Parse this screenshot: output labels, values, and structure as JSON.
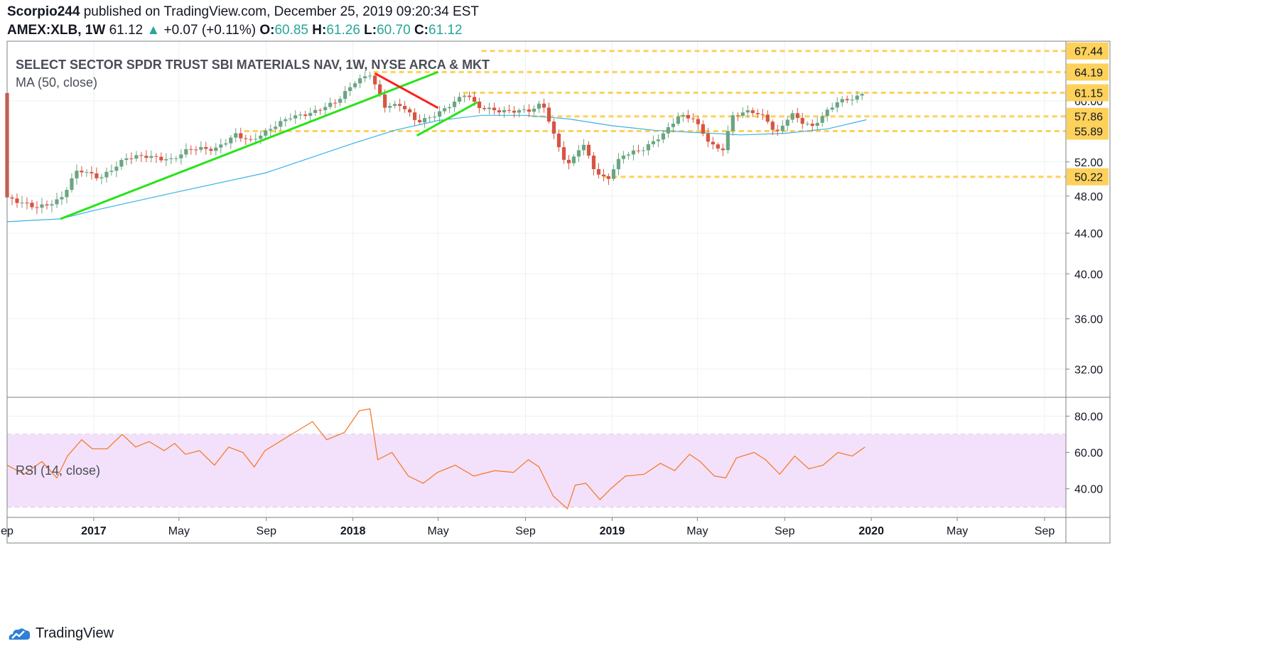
{
  "header": {
    "author": "Scorpio244",
    "published_text": "published on TradingView.com, December 25, 2019 09:20:34 EST",
    "symbol": "AMEX:XLB, 1W",
    "last": "61.12",
    "change_arrow": "▲",
    "change": "+0.07 (+0.11%)",
    "o_label": "O:",
    "o_value": "60.85",
    "h_label": "H:",
    "h_value": "61.26",
    "l_label": "L:",
    "l_value": "60.70",
    "c_label": "C:",
    "c_value": "61.12"
  },
  "price_pane": {
    "title": "SELECT SECTOR SPDR TRUST SBI MATERIALS NAV, 1W, NYSE ARCA & MKT",
    "indicator": "MA (50, close)"
  },
  "rsi_pane": {
    "indicator": "RSI (14, close)"
  },
  "footer": {
    "brand": "TradingView"
  },
  "colors": {
    "up_candle": "#6ba583",
    "down_candle": "#d75442",
    "ma_line": "#3bb3e4",
    "rsi_line": "#f57c2e",
    "rsi_band": "#f3e1fb",
    "level_line": "#fdd15a",
    "trend_green": "#29e31b",
    "trend_red": "#ff1f1f",
    "grid": "#eef0f3"
  },
  "chart_data": [
    {
      "type": "candlestick",
      "title": "SELECT SECTOR SPDR TRUST SBI MATERIALS NAV, 1W, NYSE ARCA & MKT",
      "xlim": [
        "2016-09-01",
        "2020-10-01"
      ],
      "ylim": [
        30,
        69
      ],
      "y_scale": "log",
      "y_ticks": [
        32.0,
        36.0,
        40.0,
        44.0,
        48.0,
        52.0,
        60.0
      ],
      "x_ticks": [
        {
          "label": "ep",
          "date": "2016-09-01"
        },
        {
          "label": "2017",
          "date": "2017-01-01"
        },
        {
          "label": "May",
          "date": "2017-05-01"
        },
        {
          "label": "Sep",
          "date": "2017-09-01"
        },
        {
          "label": "2018",
          "date": "2018-01-01"
        },
        {
          "label": "May",
          "date": "2018-05-01"
        },
        {
          "label": "Sep",
          "date": "2018-09-01"
        },
        {
          "label": "2019",
          "date": "2019-01-01"
        },
        {
          "label": "May",
          "date": "2019-05-01"
        },
        {
          "label": "Sep",
          "date": "2019-09-01"
        },
        {
          "label": "2020",
          "date": "2020-01-01"
        },
        {
          "label": "May",
          "date": "2020-05-01"
        },
        {
          "label": "Sep",
          "date": "2020-09-01"
        }
      ],
      "close_series": [
        [
          "2016-09-01",
          47.6
        ],
        [
          "2016-10-15",
          46.9
        ],
        [
          "2016-11-15",
          47.5
        ],
        [
          "2016-12-10",
          51.0
        ],
        [
          "2017-01-10",
          50.2
        ],
        [
          "2017-02-15",
          52.4
        ],
        [
          "2017-03-15",
          52.6
        ],
        [
          "2017-04-20",
          52.4
        ],
        [
          "2017-05-15",
          53.6
        ],
        [
          "2017-06-20",
          53.4
        ],
        [
          "2017-07-20",
          55.6
        ],
        [
          "2017-08-10",
          54.7
        ],
        [
          "2017-09-01",
          55.7
        ],
        [
          "2017-10-05",
          57.8
        ],
        [
          "2017-11-05",
          58.5
        ],
        [
          "2017-12-10",
          59.8
        ],
        [
          "2018-01-05",
          62.8
        ],
        [
          "2018-01-25",
          64.0
        ],
        [
          "2018-02-15",
          59.3
        ],
        [
          "2018-03-10",
          59.3
        ],
        [
          "2018-04-01",
          57.0
        ],
        [
          "2018-04-20",
          57.8
        ],
        [
          "2018-05-15",
          59.3
        ],
        [
          "2018-06-10",
          61.0
        ],
        [
          "2018-06-25",
          59.0
        ],
        [
          "2018-07-25",
          58.7
        ],
        [
          "2018-08-20",
          58.7
        ],
        [
          "2018-09-10",
          58.6
        ],
        [
          "2018-09-25",
          59.6
        ],
        [
          "2018-10-10",
          55.5
        ],
        [
          "2018-10-30",
          51.5
        ],
        [
          "2018-11-20",
          54.5
        ],
        [
          "2018-12-10",
          50.5
        ],
        [
          "2018-12-25",
          49.7
        ],
        [
          "2019-01-15",
          52.8
        ],
        [
          "2019-02-15",
          53.8
        ],
        [
          "2019-03-15",
          55.5
        ],
        [
          "2019-04-05",
          57.8
        ],
        [
          "2019-04-25",
          57.6
        ],
        [
          "2019-05-20",
          54.3
        ],
        [
          "2019-06-05",
          53.4
        ],
        [
          "2019-06-20",
          57.8
        ],
        [
          "2019-07-15",
          58.5
        ],
        [
          "2019-08-05",
          57.8
        ],
        [
          "2019-08-20",
          55.6
        ],
        [
          "2019-09-10",
          58.3
        ],
        [
          "2019-09-25",
          57.0
        ],
        [
          "2019-10-10",
          56.3
        ],
        [
          "2019-10-30",
          58.5
        ],
        [
          "2019-11-15",
          60.1
        ],
        [
          "2019-12-10",
          60.5
        ],
        [
          "2019-12-23",
          61.12
        ]
      ],
      "ma": {
        "name": "MA (50, close)",
        "points": [
          [
            "2016-09-01",
            45.2
          ],
          [
            "2016-11-15",
            45.5
          ],
          [
            "2017-01-01",
            46.4
          ],
          [
            "2017-05-01",
            48.5
          ],
          [
            "2017-09-01",
            50.7
          ],
          [
            "2018-01-01",
            54.3
          ],
          [
            "2018-03-01",
            56.0
          ],
          [
            "2018-05-01",
            57.3
          ],
          [
            "2018-07-01",
            58.0
          ],
          [
            "2018-09-01",
            58.0
          ],
          [
            "2018-11-01",
            57.5
          ],
          [
            "2019-01-01",
            56.6
          ],
          [
            "2019-03-01",
            56.0
          ],
          [
            "2019-05-01",
            55.7
          ],
          [
            "2019-07-01",
            55.4
          ],
          [
            "2019-09-01",
            55.6
          ],
          [
            "2019-11-01",
            56.2
          ],
          [
            "2019-12-25",
            57.4
          ]
        ]
      },
      "horizontal_levels": [
        {
          "price": 67.44,
          "label": "67.44",
          "from": "2018-07-01"
        },
        {
          "price": 64.19,
          "label": "64.19",
          "from": "2018-01-30"
        },
        {
          "price": 61.15,
          "label": "61.15",
          "from": "2018-06-05"
        },
        {
          "price": 57.86,
          "label": "57.86",
          "from": "2018-09-10"
        },
        {
          "price": 55.89,
          "label": "55.89",
          "from": "2017-08-01"
        },
        {
          "price": 50.22,
          "label": "50.22",
          "from": "2018-12-20"
        }
      ],
      "trend_lines": [
        {
          "color": "green",
          "from": [
            "2016-11-15",
            45.5
          ],
          "to": [
            "2018-05-01",
            64.2
          ]
        },
        {
          "color": "red",
          "from": [
            "2018-02-01",
            64.0
          ],
          "to": [
            "2018-05-01",
            59.0
          ]
        },
        {
          "color": "green",
          "from": [
            "2018-04-01",
            55.3
          ],
          "to": [
            "2018-06-25",
            59.8
          ]
        }
      ]
    },
    {
      "type": "line",
      "title": "RSI (14, close)",
      "ylim": [
        25,
        90
      ],
      "y_ticks": [
        40.0,
        60.0,
        80.0
      ],
      "band": [
        30,
        70
      ],
      "series": [
        {
          "points": [
            [
              "2016-09-01",
              53
            ],
            [
              "2016-09-25",
              48
            ],
            [
              "2016-10-20",
              55
            ],
            [
              "2016-11-10",
              46
            ],
            [
              "2016-11-25",
              58
            ],
            [
              "2016-12-15",
              67
            ],
            [
              "2016-12-30",
              62
            ],
            [
              "2017-01-20",
              62
            ],
            [
              "2017-02-10",
              70
            ],
            [
              "2017-03-01",
              63
            ],
            [
              "2017-03-20",
              66
            ],
            [
              "2017-04-10",
              61
            ],
            [
              "2017-04-25",
              65
            ],
            [
              "2017-05-10",
              59
            ],
            [
              "2017-05-30",
              61
            ],
            [
              "2017-06-20",
              53
            ],
            [
              "2017-07-10",
              63
            ],
            [
              "2017-07-30",
              60
            ],
            [
              "2017-08-15",
              52
            ],
            [
              "2017-08-30",
              61
            ],
            [
              "2017-09-20",
              66
            ],
            [
              "2017-10-15",
              72
            ],
            [
              "2017-11-05",
              77
            ],
            [
              "2017-11-25",
              67
            ],
            [
              "2017-12-20",
              71
            ],
            [
              "2018-01-10",
              83
            ],
            [
              "2018-01-25",
              84
            ],
            [
              "2018-02-05",
              56
            ],
            [
              "2018-02-25",
              60
            ],
            [
              "2018-03-20",
              47
            ],
            [
              "2018-04-10",
              43
            ],
            [
              "2018-04-30",
              49
            ],
            [
              "2018-05-25",
              53
            ],
            [
              "2018-06-20",
              47
            ],
            [
              "2018-07-20",
              50
            ],
            [
              "2018-08-15",
              49
            ],
            [
              "2018-09-05",
              56
            ],
            [
              "2018-09-20",
              52
            ],
            [
              "2018-10-10",
              36
            ],
            [
              "2018-10-30",
              29
            ],
            [
              "2018-11-10",
              42
            ],
            [
              "2018-11-25",
              43
            ],
            [
              "2018-12-15",
              34
            ],
            [
              "2018-12-30",
              40
            ],
            [
              "2019-01-20",
              47
            ],
            [
              "2019-02-15",
              48
            ],
            [
              "2019-03-10",
              54
            ],
            [
              "2019-03-30",
              50
            ],
            [
              "2019-04-20",
              59
            ],
            [
              "2019-05-05",
              55
            ],
            [
              "2019-05-25",
              47
            ],
            [
              "2019-06-10",
              46
            ],
            [
              "2019-06-25",
              57
            ],
            [
              "2019-07-20",
              60
            ],
            [
              "2019-08-05",
              56
            ],
            [
              "2019-08-25",
              48
            ],
            [
              "2019-09-15",
              58
            ],
            [
              "2019-10-05",
              51
            ],
            [
              "2019-10-25",
              53
            ],
            [
              "2019-11-15",
              60
            ],
            [
              "2019-12-05",
              58
            ],
            [
              "2019-12-23",
              63
            ]
          ]
        }
      ]
    }
  ]
}
